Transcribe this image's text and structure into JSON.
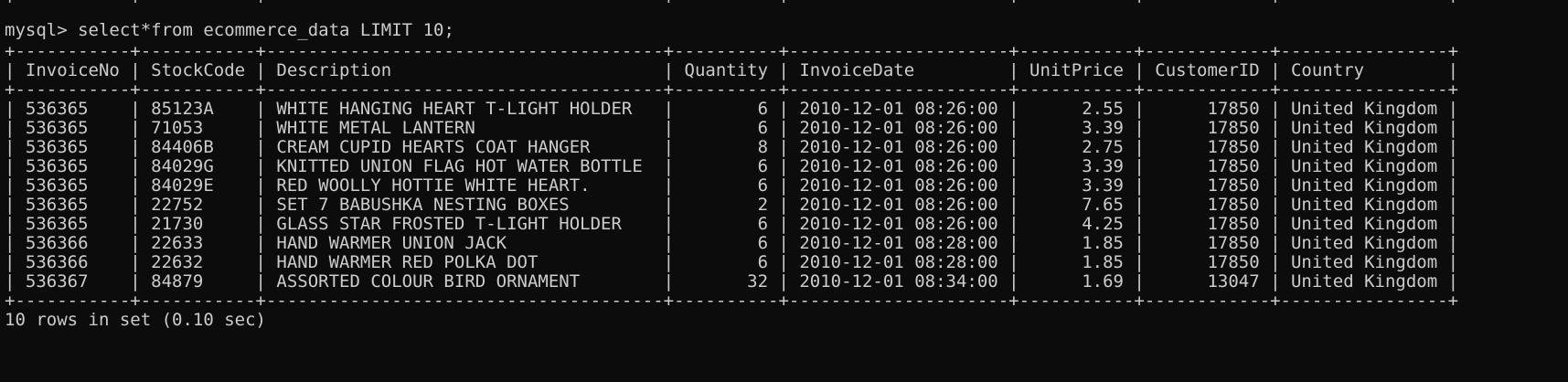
{
  "terminal": {
    "prompt": "mysql> ",
    "command": "select*from ecommerce_data LIMIT 10;",
    "border": "+-----------+-----------+--------------------------------------+----------+---------------------+-----------+------------+----------------+",
    "header": "| InvoiceNo | StockCode | Description                          | Quantity | InvoiceDate         | UnitPrice | CustomerID | Country        |",
    "rows": [
      "| 536365    | 85123A    | WHITE HANGING HEART T-LIGHT HOLDER   |        6 | 2010-12-01 08:26:00 |      2.55 |      17850 | United Kingdom |",
      "| 536365    | 71053     | WHITE METAL LANTERN                  |        6 | 2010-12-01 08:26:00 |      3.39 |      17850 | United Kingdom |",
      "| 536365    | 84406B    | CREAM CUPID HEARTS COAT HANGER       |        8 | 2010-12-01 08:26:00 |      2.75 |      17850 | United Kingdom |",
      "| 536365    | 84029G    | KNITTED UNION FLAG HOT WATER BOTTLE  |        6 | 2010-12-01 08:26:00 |      3.39 |      17850 | United Kingdom |",
      "| 536365    | 84029E    | RED WOOLLY HOTTIE WHITE HEART.       |        6 | 2010-12-01 08:26:00 |      3.39 |      17850 | United Kingdom |",
      "| 536365    | 22752     | SET 7 BABUSHKA NESTING BOXES         |        2 | 2010-12-01 08:26:00 |      7.65 |      17850 | United Kingdom |",
      "| 536365    | 21730     | GLASS STAR FROSTED T-LIGHT HOLDER    |        6 | 2010-12-01 08:26:00 |      4.25 |      17850 | United Kingdom |",
      "| 536366    | 22633     | HAND WARMER UNION JACK               |        6 | 2010-12-01 08:28:00 |      1.85 |      17850 | United Kingdom |",
      "| 536366    | 22632     | HAND WARMER RED POLKA DOT            |        6 | 2010-12-01 08:28:00 |      1.85 |      17850 | United Kingdom |",
      "| 536367    | 84879     | ASSORTED COLOUR BIRD ORNAMENT        |       32 | 2010-12-01 08:34:00 |      1.69 |      13047 | United Kingdom |"
    ],
    "footer": "10 rows in set (0.10 sec)"
  },
  "colors": {
    "background": "#0c0c0c",
    "text": "#cccccc"
  }
}
